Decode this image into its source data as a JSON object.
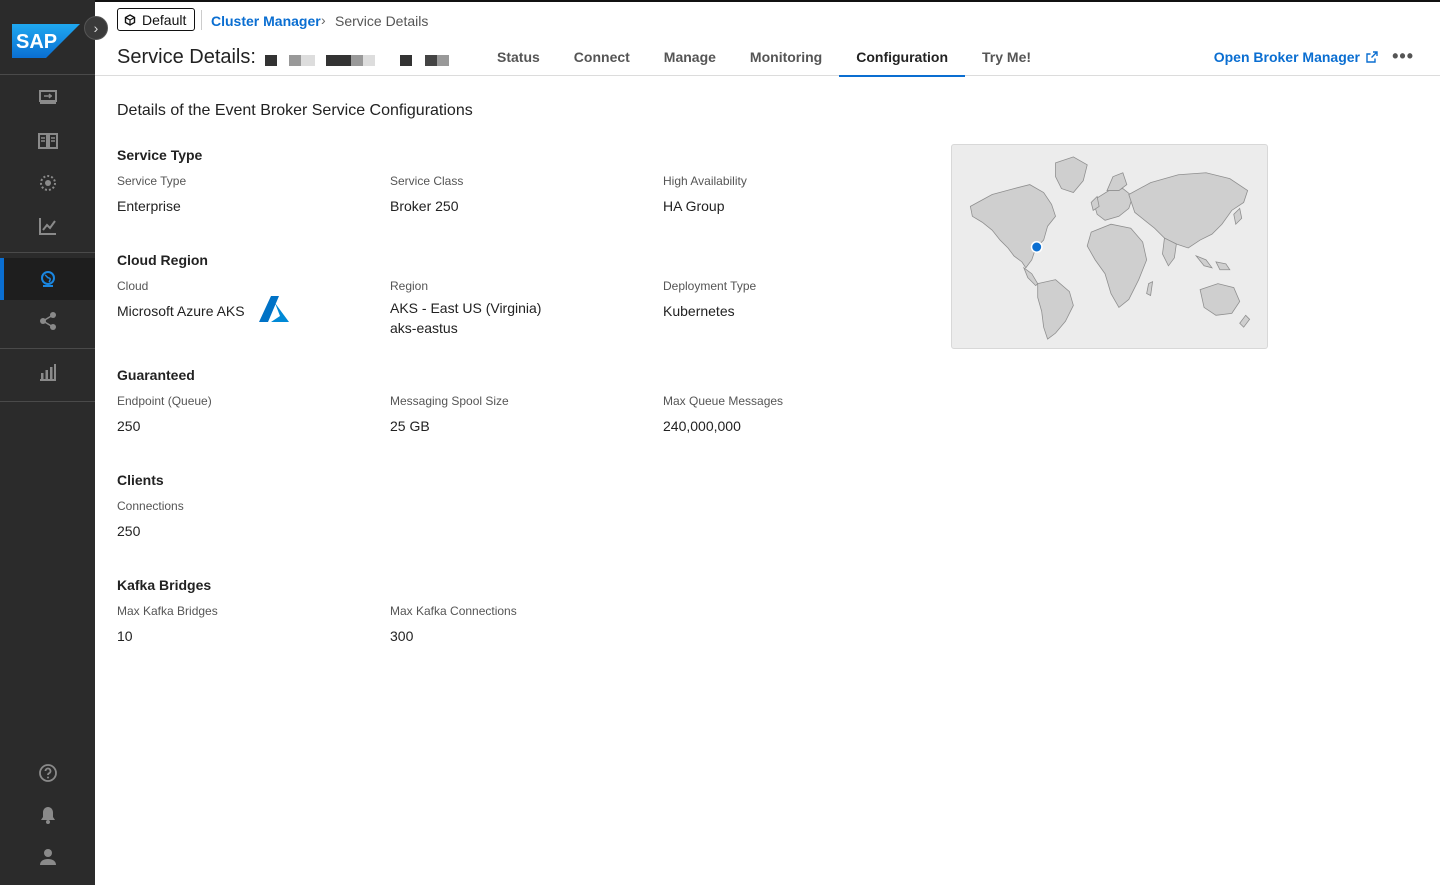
{
  "brand": {
    "logo_text": "SAP",
    "accent": "#0a6ed1"
  },
  "sidebar": {
    "items": [
      {
        "name": "sidebar-item-broker",
        "icon": "broker-icon"
      },
      {
        "name": "sidebar-item-catalog",
        "icon": "book-icon"
      },
      {
        "name": "sidebar-item-designer",
        "icon": "globe-dots-icon"
      },
      {
        "name": "sidebar-item-insights",
        "icon": "line-chart-icon"
      },
      {
        "name": "sidebar-item-cluster-manager",
        "icon": "globe-icon",
        "active": true
      },
      {
        "name": "sidebar-item-mesh",
        "icon": "share-icon"
      },
      {
        "name": "sidebar-item-reports",
        "icon": "bar-chart-icon"
      }
    ],
    "bottom": [
      "help-icon",
      "bell-icon",
      "user-icon"
    ]
  },
  "header": {
    "environment": "Default",
    "breadcrumb_link": "Cluster Manager",
    "breadcrumb_current": "Service Details",
    "title": "Service Details:",
    "tabs": [
      {
        "label": "Status"
      },
      {
        "label": "Connect"
      },
      {
        "label": "Manage"
      },
      {
        "label": "Monitoring"
      },
      {
        "label": "Configuration",
        "active": true
      },
      {
        "label": "Try Me!"
      }
    ],
    "open_broker_label": "Open Broker Manager",
    "more_label": "•••"
  },
  "main": {
    "heading": "Details of the Event Broker Service Configurations",
    "sections": {
      "service_type": {
        "title": "Service Type",
        "fields": [
          {
            "label": "Service Type",
            "value": "Enterprise"
          },
          {
            "label": "Service Class",
            "value": "Broker 250"
          },
          {
            "label": "High Availability",
            "value": "HA Group"
          }
        ]
      },
      "cloud_region": {
        "title": "Cloud Region",
        "fields": [
          {
            "label": "Cloud",
            "value": "Microsoft Azure AKS"
          },
          {
            "label": "Region",
            "value": "AKS - East US (Virginia)",
            "value2": "aks-eastus"
          },
          {
            "label": "Deployment Type",
            "value": "Kubernetes"
          }
        ]
      },
      "guaranteed": {
        "title": "Guaranteed",
        "fields": [
          {
            "label": "Endpoint (Queue)",
            "value": "250"
          },
          {
            "label": "Messaging Spool Size",
            "value": "25 GB"
          },
          {
            "label": "Max Queue Messages",
            "value": "240,000,000"
          }
        ]
      },
      "clients": {
        "title": "Clients",
        "fields": [
          {
            "label": "Connections",
            "value": "250"
          }
        ]
      },
      "kafka": {
        "title": "Kafka Bridges",
        "fields": [
          {
            "label": "Max Kafka Bridges",
            "value": "10"
          },
          {
            "label": "Max Kafka Connections",
            "value": "300"
          }
        ]
      }
    }
  }
}
